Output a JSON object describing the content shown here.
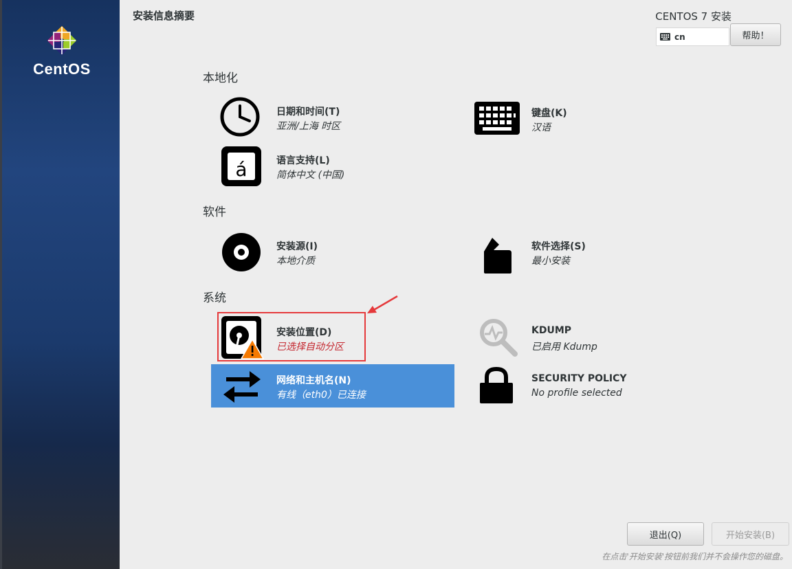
{
  "sidebar": {
    "logo_text": "CentOS"
  },
  "header": {
    "title": "安装信息摘要",
    "product": "CENTOS 7 安装",
    "keyboard_layout": "cn",
    "help_label": "帮助！"
  },
  "sections": {
    "localization": "本地化",
    "software": "软件",
    "system": "系统"
  },
  "spokes": {
    "datetime": {
      "title": "日期和时间(T)",
      "status": "亚洲/上海 时区"
    },
    "keyboard": {
      "title": "键盘(K)",
      "status": "汉语"
    },
    "language": {
      "title": "语言支持(L)",
      "status": "简体中文 (中国)"
    },
    "source": {
      "title": "安装源(I)",
      "status": "本地介质"
    },
    "software_selection": {
      "title": "软件选择(S)",
      "status": "最小安装"
    },
    "destination": {
      "title": "安装位置(D)",
      "status": "已选择自动分区"
    },
    "kdump": {
      "title": "KDUMP",
      "status": "已启用 Kdump"
    },
    "network": {
      "title": "网络和主机名(N)",
      "status": "有线（eth0）已连接"
    },
    "security": {
      "title": "SECURITY POLICY",
      "status": "No profile selected"
    }
  },
  "footer": {
    "quit_label": "退出(Q)",
    "begin_label": "开始安装(B)",
    "note": "在点击'开始安装'按钮前我们并不会操作您的磁盘。"
  },
  "colors": {
    "selected_bg": "#4a90d9",
    "warning_text": "#c4262e",
    "annotation_red": "#e5393b"
  }
}
